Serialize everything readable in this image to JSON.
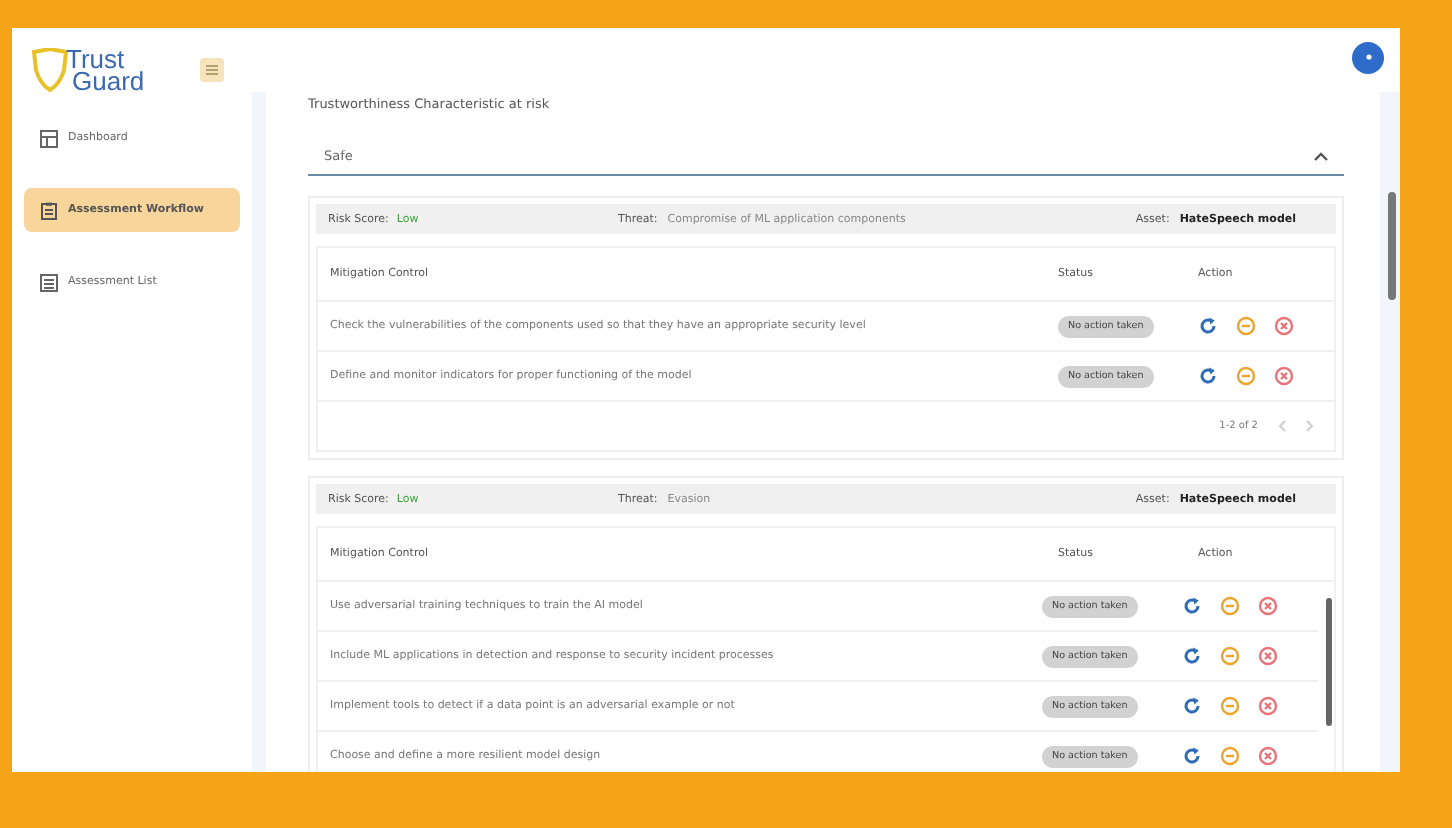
{
  "brand": {
    "line1": "Trust",
    "line2": "Guard"
  },
  "sidebar": {
    "items": [
      {
        "label": "Dashboard",
        "selected": false
      },
      {
        "label": "Assessment Workflow",
        "selected": true
      },
      {
        "label": "Assessment List",
        "selected": false
      }
    ]
  },
  "characteristic": {
    "label": "Trustworthiness Characteristic at risk",
    "value": "Safe"
  },
  "risks": [
    {
      "risk_score_label": "Risk Score:",
      "risk_score": "Low",
      "threat_label": "Threat:",
      "threat": "Compromise of ML application components",
      "asset_label": "Asset:",
      "asset": "HateSpeech model",
      "columns": [
        "Mitigation Control",
        "Status",
        "Action"
      ],
      "rows": [
        {
          "control": "Check the vulnerabilities of the components used so that they have an appropriate security level",
          "status": "No action taken"
        },
        {
          "control": "Define and monitor indicators for proper functioning of the model",
          "status": "No action taken"
        }
      ],
      "pagination": "1-2 of 2"
    },
    {
      "risk_score_label": "Risk Score:",
      "risk_score": "Low",
      "threat_label": "Threat:",
      "threat": "Evasion",
      "asset_label": "Asset:",
      "asset": "HateSpeech model",
      "columns": [
        "Mitigation Control",
        "Status",
        "Action"
      ],
      "rows": [
        {
          "control": "Use adversarial training techniques to train the AI model",
          "status": "No action taken"
        },
        {
          "control": "Include ML applications in detection and response to security incident processes",
          "status": "No action taken"
        },
        {
          "control": "Implement tools to detect if a data point is an adversarial example or not",
          "status": "No action taken"
        },
        {
          "control": "Choose and define a more resilient model design",
          "status": "No action taken"
        }
      ]
    }
  ]
}
